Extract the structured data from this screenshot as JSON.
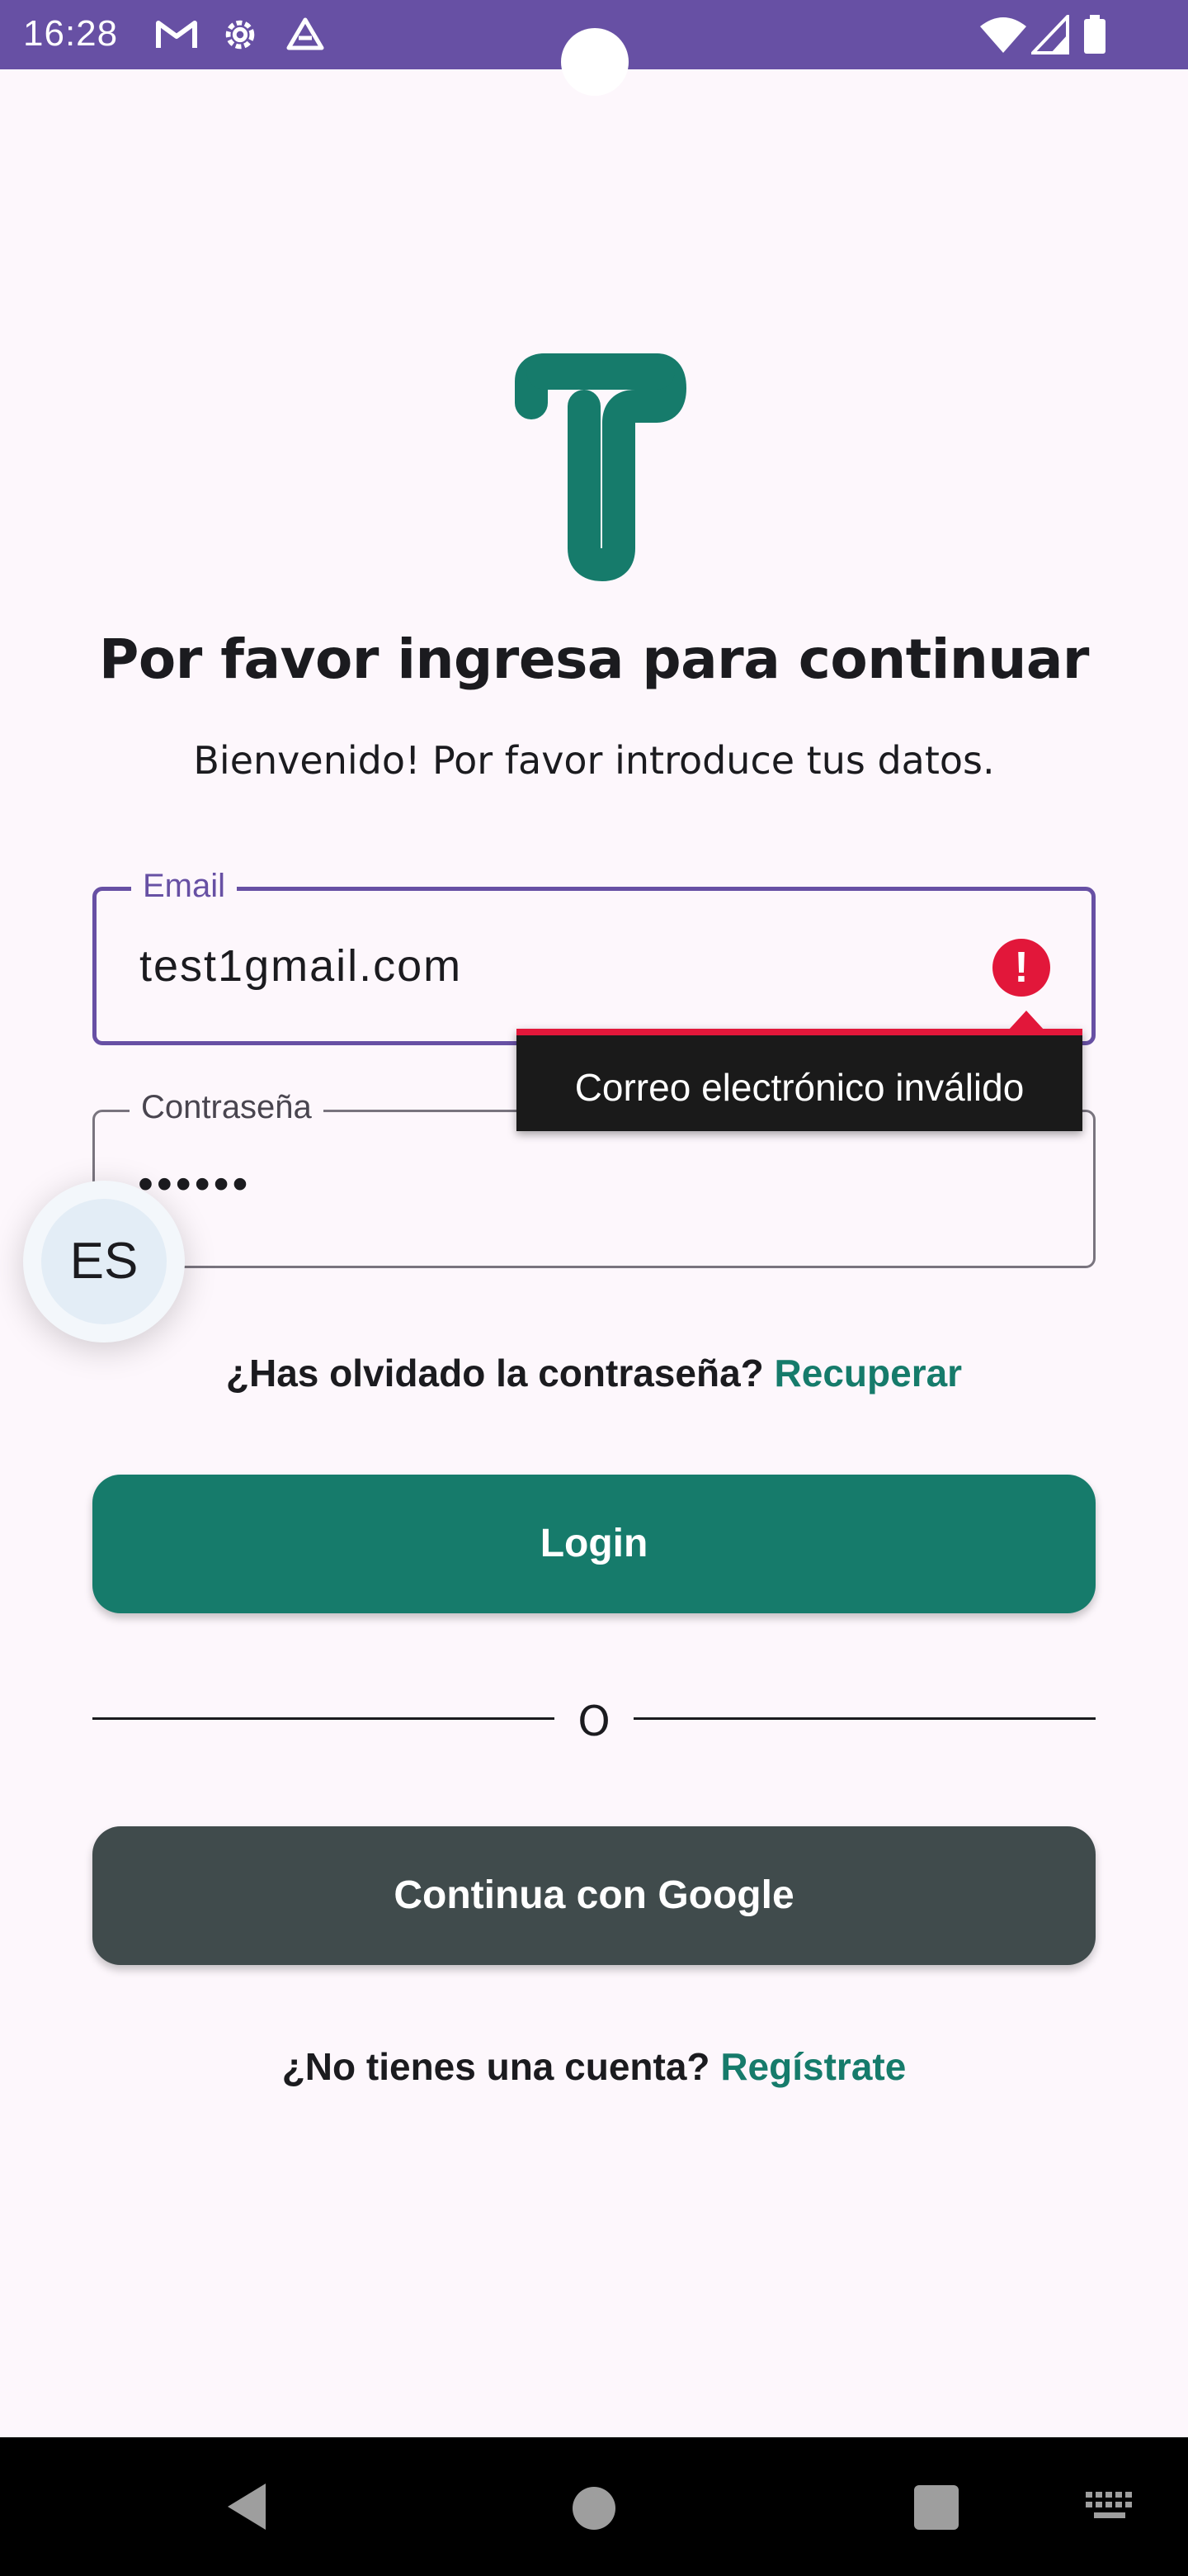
{
  "status_bar": {
    "time": "16:28",
    "left_icons": [
      "gmail-icon",
      "settings-icon",
      "drive-icon"
    ],
    "right_icons": [
      "wifi-icon",
      "signal-icon",
      "battery-icon"
    ]
  },
  "colors": {
    "status_bar": "#6750a4",
    "background": "#fdf7fc",
    "primary_teal": "#167b6b",
    "google_button": "#404b4c",
    "error_red": "#e2173a",
    "focus_outline": "#6750a4"
  },
  "logo": {
    "icon": "brand-t-logo"
  },
  "header": {
    "title": "Por favor ingresa para continuar",
    "subtitle": "Bienvenido! Por favor introduce tus datos."
  },
  "email_field": {
    "label": "Email",
    "value": "test1gmail.com",
    "error_icon": "!",
    "error_message": "Correo electrónico inválido"
  },
  "password_field": {
    "label": "Contraseña",
    "value": "••••••"
  },
  "language_button": {
    "label": "ES"
  },
  "forgot_password": {
    "prompt": "¿Has olvidado la contraseña?",
    "link": "Recuperar"
  },
  "login_button": {
    "label": "Login"
  },
  "divider": {
    "text": "O"
  },
  "google_button": {
    "label": "Continua con Google"
  },
  "signup": {
    "prompt": "¿No tienes una cuenta?",
    "link": "Regístrate"
  },
  "nav_bar": {
    "icons": [
      "back-icon",
      "home-icon",
      "recents-icon",
      "keyboard-icon"
    ]
  }
}
